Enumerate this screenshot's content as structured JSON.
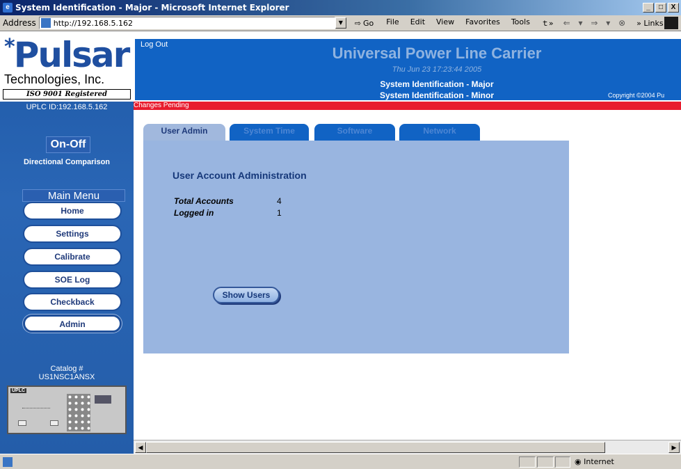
{
  "window": {
    "title": "System Identification - Major - Microsoft Internet Explorer",
    "controls": [
      "_",
      "□",
      "X"
    ]
  },
  "addressbar": {
    "label": "Address",
    "url": "http://192.168.5.162",
    "go_label": "Go",
    "menu": [
      "File",
      "Edit",
      "View",
      "Favorites",
      "Tools"
    ],
    "overflow": "ｔ»",
    "nav_icons": "⇐ ▾ ⇒ ▾ ⊗",
    "links_label": "» Links"
  },
  "sidebar": {
    "logo_text": "Pulsar",
    "logo_sub": "Technologies, Inc.",
    "iso": "ISO 9001 Registered",
    "uplc_id": "UPLC ID:192.168.5.162",
    "mode": "On-Off",
    "scheme": "Directional Comparison",
    "menu_title": "Main Menu",
    "menu_items": [
      {
        "label": "Home"
      },
      {
        "label": "Settings"
      },
      {
        "label": "Calibrate"
      },
      {
        "label": "SOE Log"
      },
      {
        "label": "Checkback"
      },
      {
        "label": "Admin"
      }
    ],
    "catalog_label": "Catalog #",
    "catalog_number": "US1NSC1ANSX",
    "device_label": "UPLC"
  },
  "header": {
    "logout": "Log Out",
    "title": "Universal Power Line Carrier",
    "datetime": "Thu Jun 23 17:23:44 2005",
    "sys_major": "System Identification - Major",
    "sys_minor": "System Identification - Minor",
    "copyright": "Copyright ©2004 Pu"
  },
  "pending": "Changes Pending",
  "tabs": [
    "User Admin",
    "System Time",
    "Software",
    "Network"
  ],
  "panel": {
    "title": "User Account Administration",
    "total_label": "Total Accounts",
    "total_value": "4",
    "logged_label": "Logged in",
    "logged_value": "1",
    "show_users": "Show Users"
  },
  "status": {
    "zone": "Internet"
  }
}
